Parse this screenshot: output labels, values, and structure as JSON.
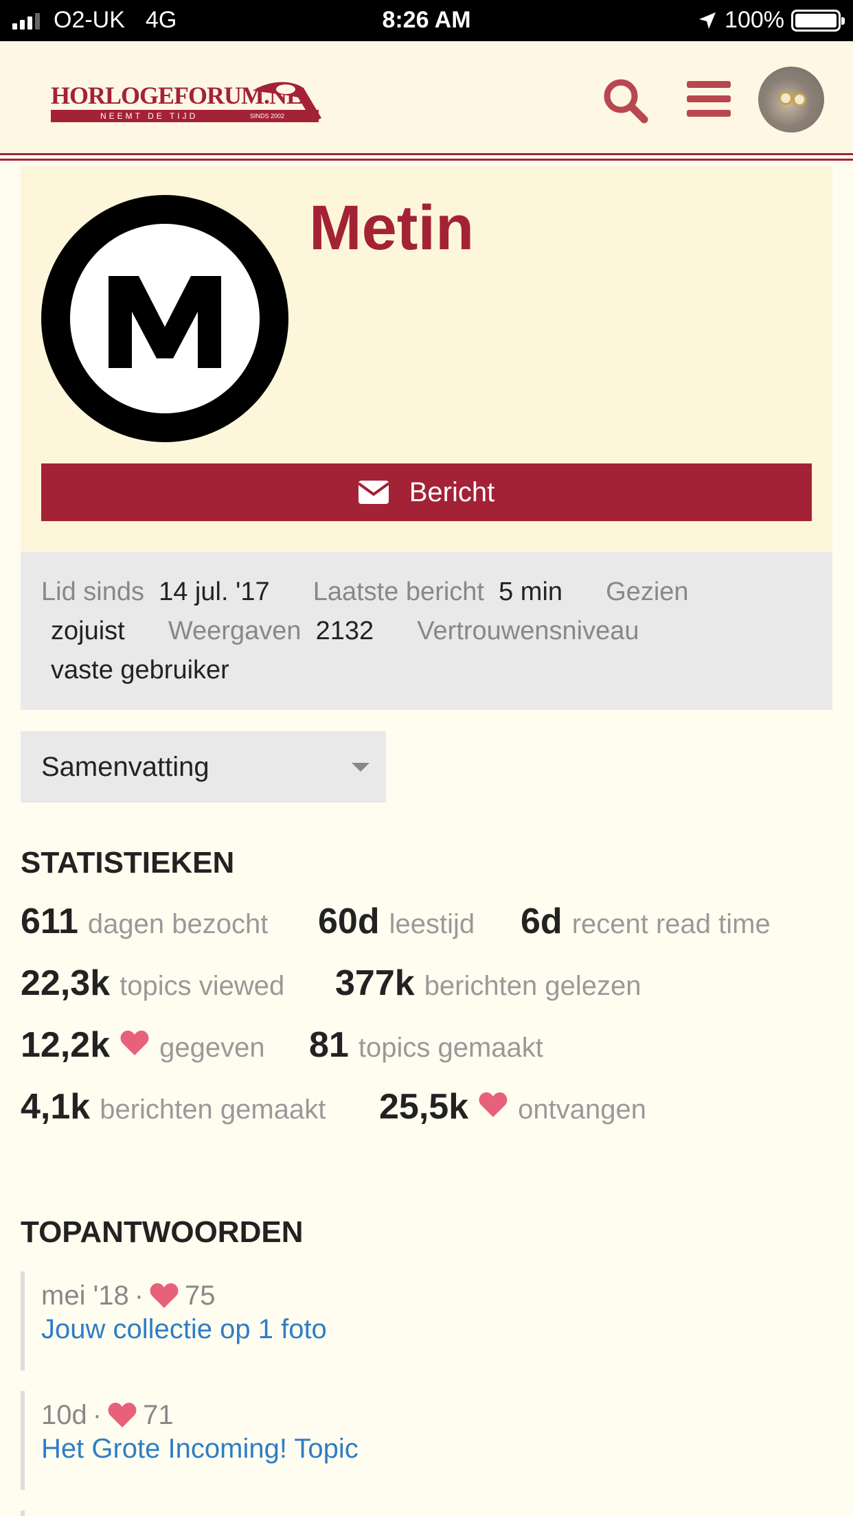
{
  "status_bar": {
    "carrier": "O2-UK",
    "network": "4G",
    "time": "8:26 AM",
    "battery": "100%"
  },
  "header": {
    "logo_text": "HORLOGEFORUM.NL",
    "logo_tagline": "NEEMT DE TIJD",
    "logo_since": "SINDS 2002",
    "icons": [
      "search-icon",
      "menu-icon",
      "user-avatar"
    ],
    "accent_color": "#a32236"
  },
  "profile": {
    "username": "Metin",
    "avatar_letter": "M",
    "message_button": "Bericht"
  },
  "meta": {
    "member_since_label": "Lid sinds",
    "member_since_value": "14 jul. '17",
    "last_post_label": "Laatste bericht",
    "last_post_value": "5 min",
    "seen_label": "Gezien",
    "seen_value": "zojuist",
    "views_label": "Weergaven",
    "views_value": "2132",
    "trust_label": "Vertrouwensniveau",
    "trust_value": "vaste gebruiker"
  },
  "summary_select": {
    "selected": "Samenvatting"
  },
  "stats": {
    "title": "STATISTIEKEN",
    "items": [
      {
        "value": "611",
        "label": "dagen bezocht"
      },
      {
        "value": "60d",
        "label": "leestijd"
      },
      {
        "value": "6d",
        "label": "recent read time"
      },
      {
        "value": "22,3k",
        "label": "topics viewed"
      },
      {
        "value": "377k",
        "label": "berichten gelezen"
      },
      {
        "value": "12,2k",
        "label": "gegeven"
      },
      {
        "value": "81",
        "label": "topics gemaakt"
      },
      {
        "value": "4,1k",
        "label": "berichten gemaakt"
      },
      {
        "value": "25,5k",
        "label": "ontvangen"
      }
    ]
  },
  "top_replies": {
    "title": "TOPANTWOORDEN",
    "items": [
      {
        "date": "mei '18",
        "likes": "75",
        "title": "Jouw collectie op 1 foto"
      },
      {
        "date": "10d",
        "likes": "71",
        "title": "Het Grote Incoming! Topic"
      }
    ]
  },
  "colors": {
    "heart": "#e8617a",
    "link": "#2e7dc6",
    "card_bg": "#fdf6da"
  }
}
